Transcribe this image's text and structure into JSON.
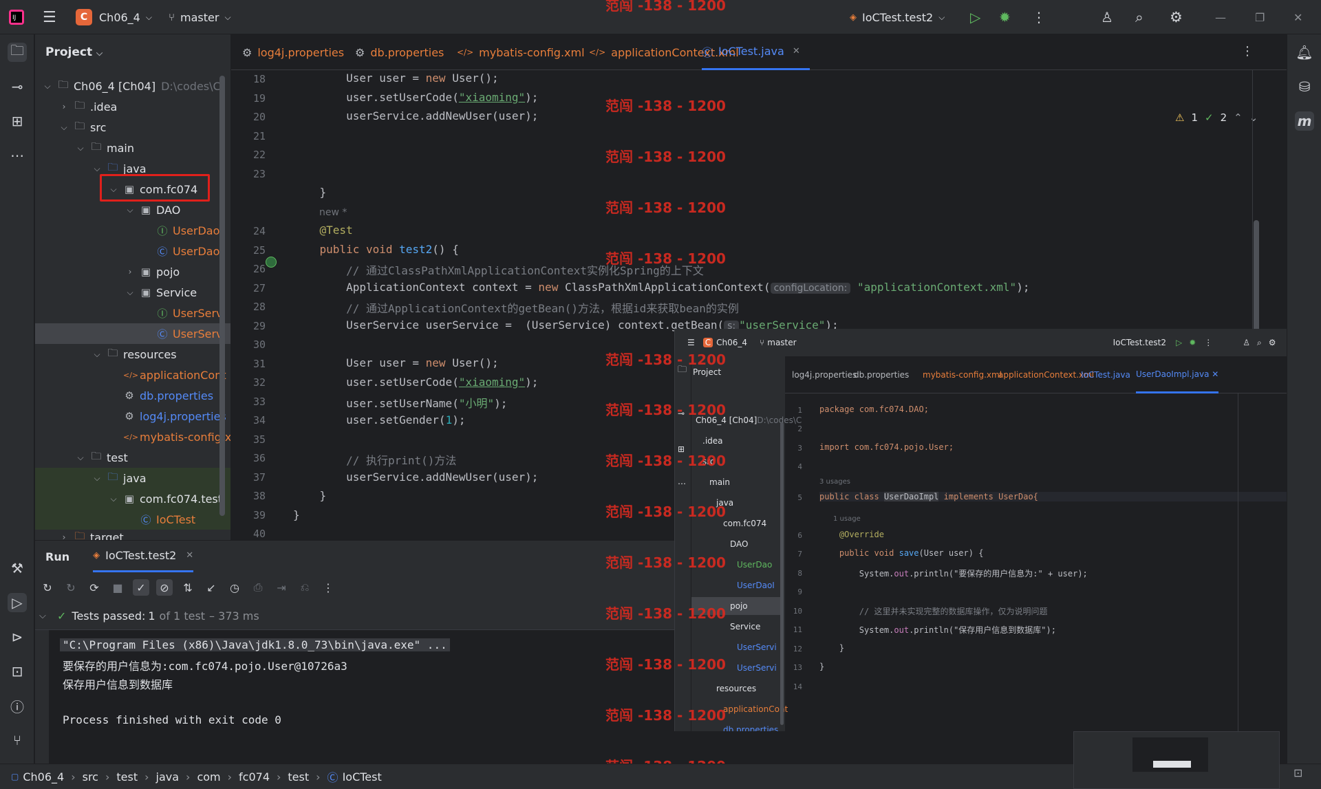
{
  "titlebar": {
    "project_badge": "C",
    "project": "Ch06_4",
    "branch": "master",
    "run_config": "IoCTest.test2"
  },
  "watermark": "范闯 -138 - 1200",
  "project_panel": {
    "title": "Project",
    "tree": [
      {
        "label": "Ch06_4 [Ch04]",
        "extra": "D:\\codes\\C",
        "icon": "folder-icon",
        "arrow": "v",
        "indent": 0,
        "type": "fold"
      },
      {
        "label": ".idea",
        "icon": "folder-icon",
        "arrow": ">",
        "indent": 1,
        "type": "fold"
      },
      {
        "label": "src",
        "icon": "folder-icon",
        "arrow": "v",
        "indent": 1,
        "type": "fold"
      },
      {
        "label": "main",
        "icon": "folder-icon",
        "arrow": "v",
        "indent": 2,
        "type": "fold"
      },
      {
        "label": "java",
        "icon": "folder-icon",
        "arrow": "v",
        "indent": 3,
        "type": "cls"
      },
      {
        "label": "com.fc074",
        "icon": "package-icon",
        "arrow": "v",
        "indent": 4,
        "type": "fold"
      },
      {
        "label": "DAO",
        "icon": "package-icon",
        "arrow": "v",
        "indent": 5,
        "type": "fold"
      },
      {
        "label": "UserDao",
        "icon": "interface-icon",
        "arrow": "",
        "indent": 6,
        "type": "intf"
      },
      {
        "label": "UserDaoI",
        "icon": "class-icon",
        "arrow": "",
        "indent": 6,
        "type": "cls"
      },
      {
        "label": "pojo",
        "icon": "package-icon",
        "arrow": ">",
        "indent": 5,
        "type": "fold"
      },
      {
        "label": "Service",
        "icon": "package-icon",
        "arrow": "v",
        "indent": 5,
        "type": "fold"
      },
      {
        "label": "UserServi",
        "icon": "interface-icon",
        "arrow": "",
        "indent": 6,
        "type": "intf"
      },
      {
        "label": "UserServi",
        "icon": "class-icon",
        "arrow": "",
        "indent": 6,
        "type": "cls",
        "selected": true
      },
      {
        "label": "resources",
        "icon": "folder-icon",
        "arrow": "v",
        "indent": 3,
        "type": "fold"
      },
      {
        "label": "applicationCont",
        "icon": "xml-icon",
        "arrow": "",
        "indent": 4,
        "type": "xml"
      },
      {
        "label": "db.properties",
        "icon": "gear-icon",
        "arrow": "",
        "indent": 4,
        "type": "prop"
      },
      {
        "label": "log4j.properties",
        "icon": "gear-icon",
        "arrow": "",
        "indent": 4,
        "type": "prop"
      },
      {
        "label": "mybatis-config.x",
        "icon": "xml-icon",
        "arrow": "",
        "indent": 4,
        "type": "xml"
      },
      {
        "label": "test",
        "icon": "folder-icon",
        "arrow": "v",
        "indent": 2,
        "type": "fold"
      },
      {
        "label": "java",
        "icon": "folder-icon",
        "arrow": "v",
        "indent": 3,
        "type": "cls",
        "green": true
      },
      {
        "label": "com.fc074.test",
        "icon": "package-icon",
        "arrow": "v",
        "indent": 4,
        "type": "fold",
        "green": true
      },
      {
        "label": "IoCTest",
        "icon": "class-icon",
        "arrow": "",
        "indent": 5,
        "type": "cls",
        "green": true
      },
      {
        "label": "target",
        "icon": "folder-icon",
        "arrow": ">",
        "indent": 1,
        "type": "xml"
      }
    ]
  },
  "editor": {
    "tabs": [
      {
        "label": "log4j.properties",
        "icon": "gear-icon"
      },
      {
        "label": "db.properties",
        "icon": "gear-icon"
      },
      {
        "label": "mybatis-config.xml",
        "icon": "xml-icon"
      },
      {
        "label": "applicationContext.xml",
        "icon": "xml-icon"
      },
      {
        "label": "IoCTest.java",
        "icon": "class-icon",
        "active": true
      }
    ],
    "inspections": {
      "warnings": "1",
      "checks": "2"
    },
    "line_numbers": [
      "18",
      "19",
      "20",
      "21",
      "22",
      "23",
      "24",
      "25",
      "26",
      "27",
      "28",
      "29",
      "30",
      "31",
      "32",
      "33",
      "34",
      "35",
      "36",
      "37",
      "38",
      "39",
      "40"
    ],
    "code": {
      "l18a": "        User user = ",
      "l18b": "new ",
      "l18c": "User();",
      "l19a": "        user.setUserCode(",
      "l19b": "\"xiaoming\"",
      "l19c": ");",
      "l20": "        userService.addNewUser(user);",
      "l23": "    }",
      "usages": "new *",
      "l24": "    @Test",
      "l25a": "    public void ",
      "l25b": "test2",
      "l25c": "() {",
      "l26": "        // 通过ClassPathXmlApplicationContext实例化Spring的上下文",
      "l27a": "        ApplicationContext context = ",
      "l27b": "new ",
      "l27c": "ClassPathXmlApplicationContext(",
      "l27hint": "configLocation:",
      "l27d": "\"applicationContext.xml\"",
      "l27e": ");",
      "l28": "        // 通过ApplicationContext的getBean()方法，根据id来获取bean的实例",
      "l29a": "        UserService userService =  (UserService) context.getBean(",
      "l29hint": "s:",
      "l29b": "\"userService\"",
      "l29c": ");",
      "l31a": "        User user = ",
      "l31b": "new ",
      "l31c": "User();",
      "l32a": "        user.setUserCode(",
      "l32b": "\"xiaoming\"",
      "l32c": ");",
      "l33a": "        user.setUserName(",
      "l33b": "\"小明\"",
      "l33c": ");",
      "l34a": "        user.setGender(",
      "l34b": "1",
      "l34c": ");",
      "l36": "        // 执行print()方法",
      "l37": "        userService.addNewUser(user);",
      "l38": "    }",
      "l39": "}"
    }
  },
  "run": {
    "title": "Run",
    "tab": "IoCTest.test2",
    "passed_label": "Tests passed: ",
    "passed_count": "1",
    "passed_of": "of 1 test",
    "passed_time": "– 373 ms",
    "console": [
      "\"C:\\Program Files (x86)\\Java\\jdk1.8.0_73\\bin\\java.exe\" ...",
      "要保存的用户信息为:com.fc074.pojo.User@10726a3",
      "保存用户信息到数据库",
      "",
      "Process finished with exit code 0"
    ]
  },
  "inset": {
    "project": "Ch06_4",
    "branch": "master",
    "run_config": "IoCTest.test2",
    "project_label": "Project",
    "tabs": [
      "log4j.properties",
      "db.properties",
      "mybatis-config.xml",
      "applicationContext.xml",
      "IoCTest.java",
      "UserDaoImpl.java"
    ],
    "tree": [
      "Ch06_4 [Ch04]",
      "D:\\codes\\C",
      ".idea",
      "src",
      "main",
      "java",
      "com.fc074",
      "DAO",
      "UserDao",
      "UserDaoI",
      "pojo",
      "Service",
      "UserServi",
      "UserServi",
      "resources",
      "applicationCont",
      "db.properties"
    ],
    "line_numbers": [
      "1",
      "2",
      "3",
      "4",
      "5",
      "6",
      "7",
      "8",
      "9",
      "10",
      "11",
      "12",
      "13",
      "14"
    ],
    "code": {
      "c1": "package com.fc074.DAO;",
      "c3": "import com.fc074.pojo.User;",
      "usages1": "3 usages",
      "c5a": "public class ",
      "c5b": "UserDaoImpl",
      "c5c": " implements UserDao{",
      "usages2": "1 usage",
      "c6": "    @Override",
      "c7a": "    public void ",
      "c7b": "save",
      "c7c": "(User user) {",
      "c8a": "        System.",
      "c8b": "out",
      "c8c": ".println(\"要保存的用户信息为:\" + user);",
      "c10": "        // 这里并未实现完整的数据库操作，仅为说明问题",
      "c11a": "        System.",
      "c11b": "out",
      "c11c": ".println(\"保存用户信息到数据库\");",
      "c12": "    }",
      "c13": "}"
    }
  },
  "statusbar": {
    "crumbs": [
      "Ch06_4",
      "src",
      "test",
      "java",
      "com",
      "fc074",
      "test",
      "IoCTest"
    ]
  }
}
